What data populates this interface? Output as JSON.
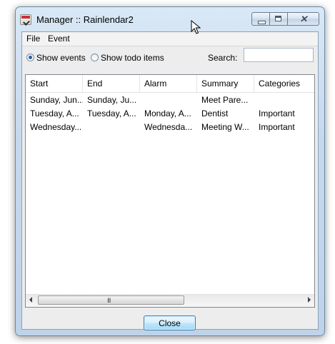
{
  "window": {
    "title": "Manager :: Rainlendar2",
    "close_glyph": "✕"
  },
  "menu": [
    "File",
    "Event"
  ],
  "options": {
    "show_events_label": "Show events",
    "show_todo_label": "Show todo items",
    "selected": "Show events",
    "search_label": "Search:",
    "search_value": ""
  },
  "list": {
    "columns": [
      "Start",
      "End",
      "Alarm",
      "Summary",
      "Categories"
    ],
    "rows": [
      [
        "Sunday, Jun...",
        "Sunday, Ju...",
        "",
        "Meet Pare...",
        ""
      ],
      [
        "Tuesday, A...",
        "Tuesday, A...",
        "Monday, A...",
        "Dentist",
        "Important"
      ],
      [
        "Wednesday...",
        "",
        "Wednesda...",
        "Meeting W...",
        "Important"
      ]
    ],
    "scroll_grip": "III"
  },
  "footer": {
    "close_label": "Close"
  },
  "icons": {
    "app": "rainlendar-app-icon",
    "minimize": "minimize-icon",
    "maximize": "maximize-icon",
    "close": "close-icon",
    "cursor": "mouse-cursor-icon"
  }
}
